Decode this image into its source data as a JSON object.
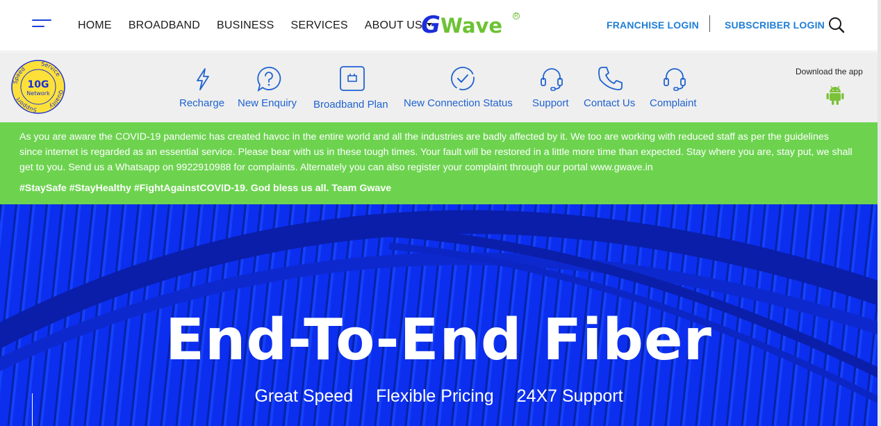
{
  "header": {
    "nav": [
      "HOME",
      "BROADBAND",
      "BUSINESS",
      "SERVICES",
      "ABOUT US"
    ],
    "logo": {
      "g": "G",
      "rest": "Wave",
      "reg": "R"
    },
    "franchise_login": "FRANCHISE LOGIN",
    "subscriber_login": "SUBSCRIBER LOGIN"
  },
  "badge": {
    "speed": "10G",
    "sub": "Network",
    "ring": [
      "Speed",
      "Service",
      "Quality",
      "Support"
    ]
  },
  "quick_links": [
    {
      "label": "Recharge",
      "icon": "bolt-icon"
    },
    {
      "label": "New Enquiry",
      "icon": "question-bubble-icon"
    },
    {
      "label": "Broadband Plan",
      "icon": "router-icon"
    },
    {
      "label": "New Connection Status",
      "icon": "check-circle-icon"
    },
    {
      "label": "Support",
      "icon": "headset-icon"
    },
    {
      "label": "Contact Us",
      "icon": "phone-icon"
    },
    {
      "label": "Complaint",
      "icon": "headset-icon"
    }
  ],
  "app": {
    "text": "Download the app",
    "icon": "android-icon"
  },
  "notice": {
    "text": "As you are aware the COVID-19 pandemic has created havoc in the entire world and all the industries are badly affected by it. We too are working with reduced staff as per the guidelines since internet is regarded as an essential service. Please bear with us in these tough times. Your fault will be restored in a little more time than expected. Stay where you are, stay put, we shall get to you. Send us a Whatsapp on 9922910988 for complaints. Alternately you can also register your complaint through our portal www.gwave.in",
    "tags": "#StaySafe #StayHealthy #FightAgainstCOVID-19. God bless us all. Team Gwave"
  },
  "hero": {
    "title": "End-To-End Fiber",
    "features": [
      "Great Speed",
      "Flexible Pricing",
      "24X7 Support"
    ]
  },
  "colors": {
    "brand_blue": "#1b2ed8",
    "brand_green": "#6dc234",
    "link_blue": "#1f62d0",
    "notice_green": "#6dd34f",
    "hero_blue": "#0a2be8"
  }
}
